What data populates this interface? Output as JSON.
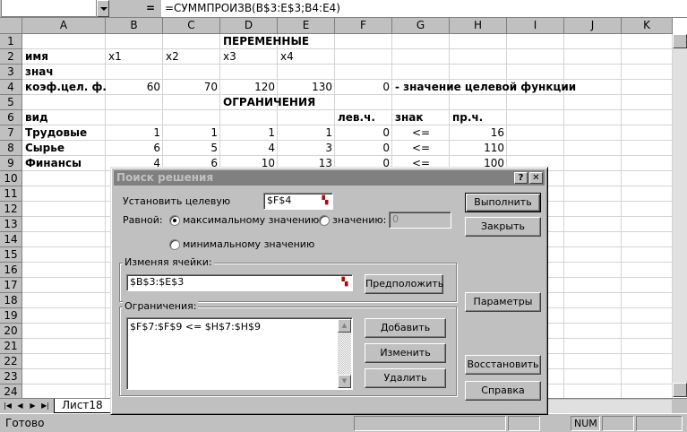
{
  "formula_bar": {
    "name_box": "",
    "equals": "=",
    "formula": "=СУММПРОИЗВ(B$3:E$3;B4:E4)"
  },
  "columns": [
    "A",
    "B",
    "C",
    "D",
    "E",
    "F",
    "G",
    "H",
    "I",
    "J",
    "K"
  ],
  "rows": [
    "1",
    "2",
    "3",
    "4",
    "5",
    "6",
    "7",
    "8",
    "9",
    "10",
    "11",
    "12",
    "13",
    "14",
    "15",
    "16",
    "17",
    "18",
    "19",
    "20",
    "21",
    "22",
    "23",
    "24"
  ],
  "cells": {
    "D1": "ПЕРЕМЕННЫЕ",
    "A2": "имя",
    "B2": "x1",
    "C2": "x2",
    "D2": "x3",
    "E2": "x4",
    "A3": "знач",
    "A4": "коэф.цел. ф.",
    "B4": "60",
    "C4": "70",
    "D4": "120",
    "E4": "130",
    "F4": "0",
    "G4": "- значение целевой функции",
    "D5": "ОГРАНИЧЕНИЯ",
    "A6": "вид",
    "F6": "лев.ч.",
    "G6": "знак",
    "H6": "пр.ч.",
    "A7": "Трудовые",
    "B7": "1",
    "C7": "1",
    "D7": "1",
    "E7": "1",
    "F7": "0",
    "G7": "<=",
    "H7": "16",
    "A8": "Сырье",
    "B8": "6",
    "C8": "5",
    "D8": "4",
    "E8": "3",
    "F8": "0",
    "G8": "<=",
    "H8": "110",
    "A9": "Финансы",
    "B9": "4",
    "C9": "6",
    "D9": "10",
    "E9": "13",
    "F9": "0",
    "G9": "<=",
    "H9": "100"
  },
  "sheet_tab": "Лист18",
  "status": {
    "text": "Готово",
    "num": "NUM"
  },
  "dialog": {
    "title": "Поиск решения",
    "help_btn": "?",
    "close_btn": "✕",
    "target_label": "Установить целевую",
    "target_value": "$F$4",
    "equal_label": "Равной:",
    "max_label": "максимальному значению",
    "value_label": "значению:",
    "value_input": "0",
    "min_label": "минимальному значению",
    "changing_group": "Изменяя ячейки:",
    "changing_value": "$B$3:$E$3",
    "guess_btn": "Предположить",
    "constraints_group": "Ограничения:",
    "constraints": [
      "$F$7:$F$9 <= $H$7:$H$9"
    ],
    "add_btn": "Добавить",
    "change_btn": "Изменить",
    "delete_btn": "Удалить",
    "solve_btn": "Выполнить",
    "close_label": "Закрыть",
    "options_btn": "Параметры",
    "reset_btn": "Восстановить",
    "help_label": "Справка"
  }
}
